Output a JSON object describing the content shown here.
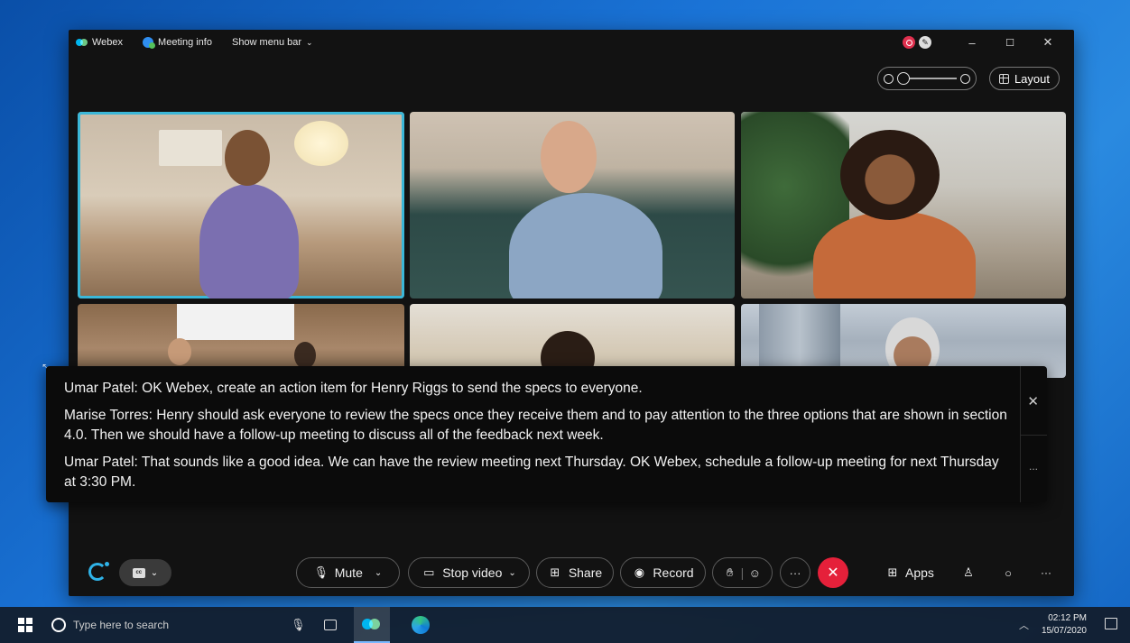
{
  "window": {
    "app_name": "Webex",
    "meeting_info_label": "Meeting info",
    "menu_bar_label": "Show menu bar",
    "minimize": "–",
    "maximize": "☐",
    "close": "✕"
  },
  "toolbar_top": {
    "layout_label": "Layout"
  },
  "tiles": [
    {
      "id": "tile-1",
      "active": true
    },
    {
      "id": "tile-2",
      "active": false
    },
    {
      "id": "tile-3",
      "active": false
    },
    {
      "id": "tile-4",
      "active": false
    },
    {
      "id": "tile-5",
      "active": false
    },
    {
      "id": "tile-6",
      "active": false
    }
  ],
  "captions": {
    "lines": [
      "Umar Patel: OK Webex, create an action item for Henry Riggs to send the specs to everyone.",
      "Marise Torres: Henry should ask everyone to review the specs once they receive them and to pay attention to the three options that are shown in section 4.0. Then we should have a follow-up meeting to discuss all of the feedback next week.",
      "Umar Patel: That sounds like a good idea. We can have the review meeting next Thursday. OK Webex, schedule a follow-up meeting for next Thursday at 3:30 PM."
    ],
    "close_glyph": "✕",
    "more_glyph": "..."
  },
  "controls": {
    "mute_label": "Mute",
    "stop_video_label": "Stop video",
    "share_label": "Share",
    "record_label": "Record",
    "more_glyph": "···",
    "end_glyph": "✕",
    "apps_label": "Apps",
    "overflow_glyph": "···",
    "cc_label": "cc"
  },
  "taskbar": {
    "search_placeholder": "Type here to search",
    "time": "02:12 PM",
    "date": "15/07/2020"
  },
  "colors": {
    "accent": "#3bb7d8",
    "end_call": "#e5203a",
    "recording": "#e0304e",
    "desktop": "#1a73d6"
  },
  "icons": [
    "webex-logo-icon",
    "info-icon",
    "record-indicator-icon",
    "zoom-out-icon",
    "zoom-in-icon",
    "grid-icon",
    "microphone-icon",
    "video-icon",
    "share-icon",
    "record-icon",
    "raise-hand-icon",
    "reaction-icon",
    "apps-icon",
    "participants-icon",
    "chat-icon",
    "windows-start-icon",
    "search-icon",
    "task-view-icon",
    "edge-icon"
  ]
}
